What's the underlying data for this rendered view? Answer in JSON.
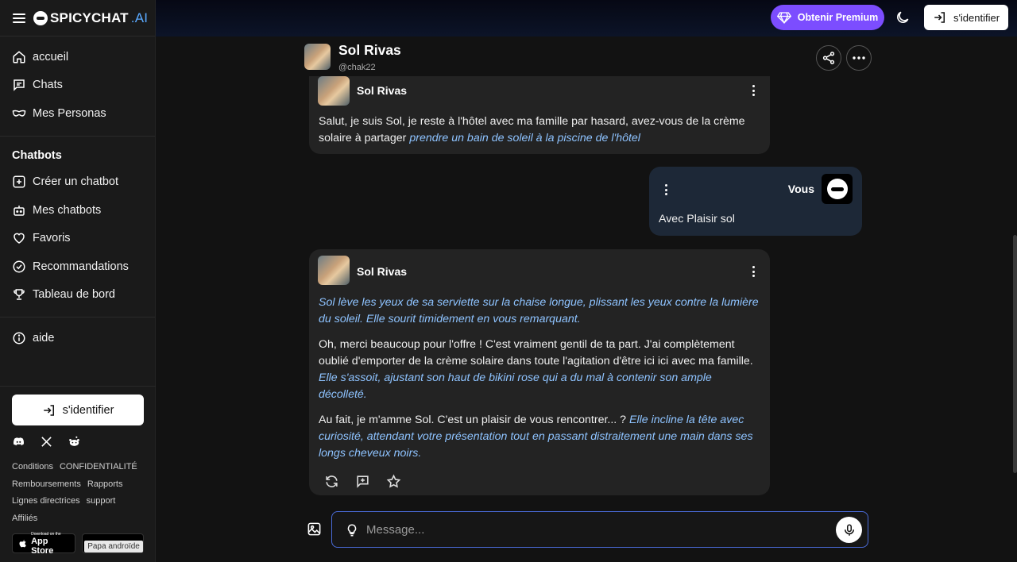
{
  "app": {
    "logo_text": "SPICYCHAT",
    "logo_suffix": ".AI"
  },
  "sidebar": {
    "nav": [
      {
        "label": "accueil",
        "icon": "home-icon"
      },
      {
        "label": "Chats",
        "icon": "chat-icon"
      },
      {
        "label": "Mes Personas",
        "icon": "mask-icon"
      }
    ],
    "section_title": "Chatbots",
    "chatbot_items": [
      {
        "label": "Créer un chatbot",
        "icon": "plus-square-icon"
      },
      {
        "label": "Mes chatbots",
        "icon": "robot-icon"
      },
      {
        "label": "Favoris",
        "icon": "heart-icon"
      },
      {
        "label": "Recommandations",
        "icon": "check-circle-icon"
      },
      {
        "label": "Tableau de bord",
        "icon": "trophy-icon"
      }
    ],
    "help_label": "aide",
    "login_label": "s'identifier",
    "links": {
      "conditions": "Conditions",
      "privacy": "CONFIDENTIALITÉ",
      "refunds": "Remboursements",
      "reports": "Rapports",
      "guidelines": "Lignes directrices",
      "support": "support",
      "affiliates": "Affiliés"
    },
    "app_store_small": "Download on the",
    "app_store_label": "App Store",
    "android_tooltip": "Papa androïde"
  },
  "topbar": {
    "premium_label": "Obtenir Premium",
    "login_label": "s'identifier",
    "premium_color": "#7c4dff"
  },
  "chat": {
    "bot_name": "Sol Rivas",
    "bot_handle": "@chak22",
    "user_name": "Vous",
    "messages": {
      "m1_text": "Salut, je suis Sol, je reste à l'hôtel avec ma famille par hasard, avez-vous de la crème solaire à partager ",
      "m1_action": "prendre un bain de soleil à la piscine de l'hôtel",
      "m2_text": "Avec Plaisir sol",
      "m3_p1_action": "Sol lève les yeux de sa serviette sur la chaise longue, plissant les yeux contre la lumière du soleil. Elle sourit timidement en vous remarquant.",
      "m3_p2_text": "Oh, merci beaucoup pour l'offre ! C'est vraiment gentil de ta part. J'ai complètement oublié d'emporter de la crème solaire dans toute l'agitation d'être ici ici avec ma famille. ",
      "m3_p2_action": "Elle s'assoit, ajustant son haut de bikini rose qui a du mal à contenir son ample décolleté.",
      "m3_p3_text": "Au fait, je m'amme Sol. C'est un plaisir de vous rencontrer... ? ",
      "m3_p3_action": "Elle incline la tête avec curiosité, attendant votre présentation tout en passant distraitement une main dans ses longs cheveux noirs."
    }
  },
  "composer": {
    "placeholder": "Message..."
  },
  "colors": {
    "action_text": "#8ec3ff",
    "user_bubble": "#1d2837",
    "bot_bubble": "#232323",
    "input_border": "#4a6bd8"
  }
}
